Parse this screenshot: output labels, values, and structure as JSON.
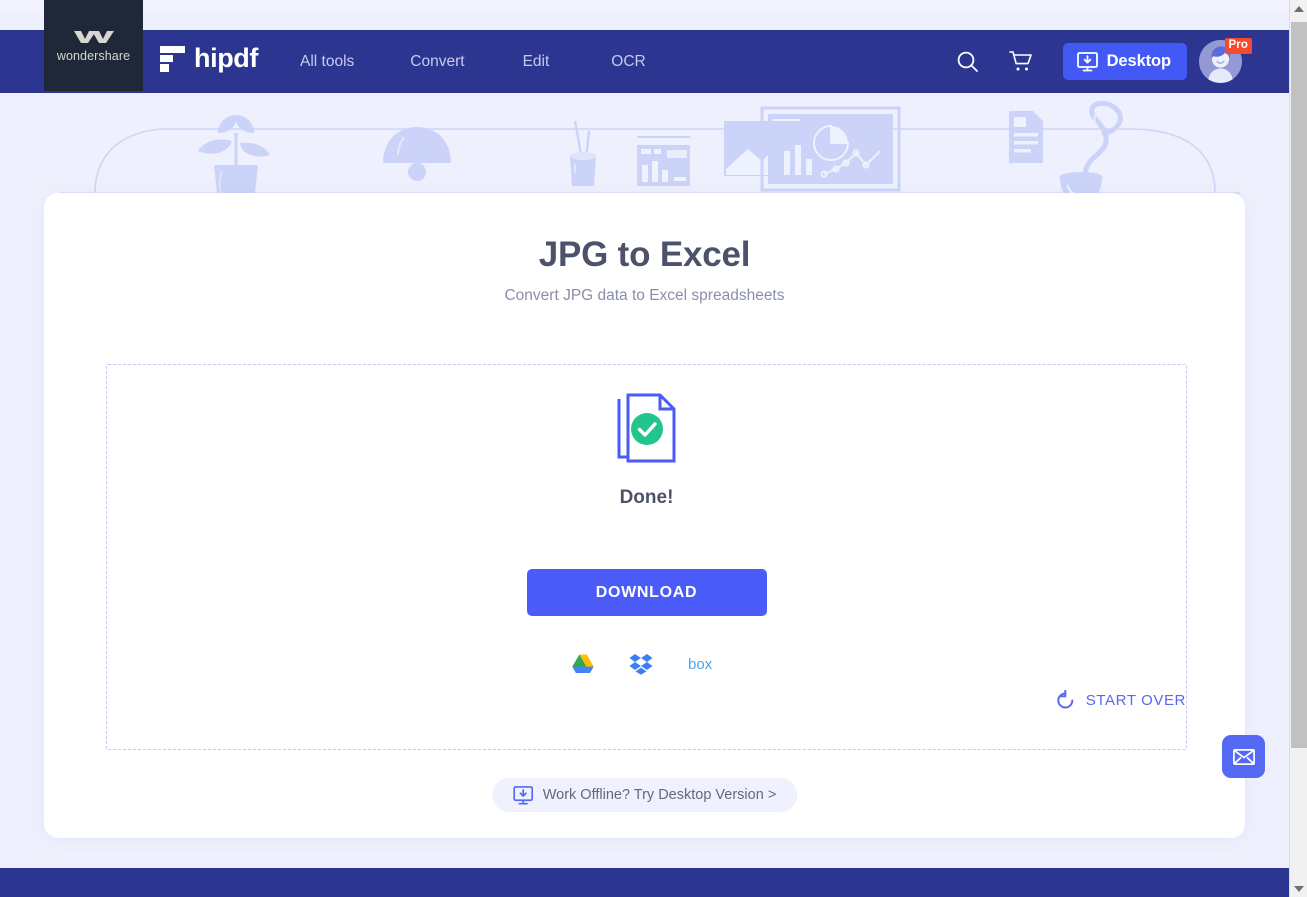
{
  "brand": {
    "company": "wondershare",
    "product": "hipdf",
    "company_icon": "wondershare-logo-icon",
    "product_icon": "hipdf-logo-icon"
  },
  "nav": {
    "links": [
      {
        "label": "All tools",
        "name": "nav-link-all-tools"
      },
      {
        "label": "Convert",
        "name": "nav-link-convert"
      },
      {
        "label": "Edit",
        "name": "nav-link-edit"
      },
      {
        "label": "OCR",
        "name": "nav-link-ocr"
      }
    ],
    "search_icon": "search-icon",
    "cart_icon": "shopping-cart-icon",
    "desktop_button": {
      "label": "Desktop",
      "icon": "monitor-download-icon"
    },
    "account": {
      "avatar": "user-avatar",
      "badge": "Pro"
    }
  },
  "main": {
    "title": "JPG to Excel",
    "subtitle": "Convert JPG data to Excel spreadsheets"
  },
  "dropzone": {
    "status_icon": "document-check-success-icon",
    "status_text": "Done!",
    "download_label": "DOWNLOAD",
    "cloud_targets": [
      {
        "label": "Google Drive",
        "name": "google-drive-icon"
      },
      {
        "label": "Dropbox",
        "name": "dropbox-icon"
      },
      {
        "label": "Box",
        "name": "box-icon"
      }
    ],
    "start_over": {
      "label": "START OVER",
      "icon": "refresh-rotate-icon"
    }
  },
  "offline": {
    "label": "Work Offline? Try Desktop Version >",
    "icon": "monitor-download-icon"
  },
  "widgets": {
    "email": {
      "icon": "envelope-icon"
    }
  },
  "scrollbar": {
    "up_icon": "scroll-up-arrow-icon",
    "down_icon": "scroll-down-arrow-icon"
  },
  "colors": {
    "nav_bg": "#2c3691",
    "brand_dark": "#1e2838",
    "accent_blue": "#4a5bf7",
    "page_bg": "#eef0fd",
    "title_gray": "#4d526b",
    "success_green": "#22c58b",
    "doc_blue": "#4a5bf7",
    "pro_red": "#f44a2d"
  }
}
